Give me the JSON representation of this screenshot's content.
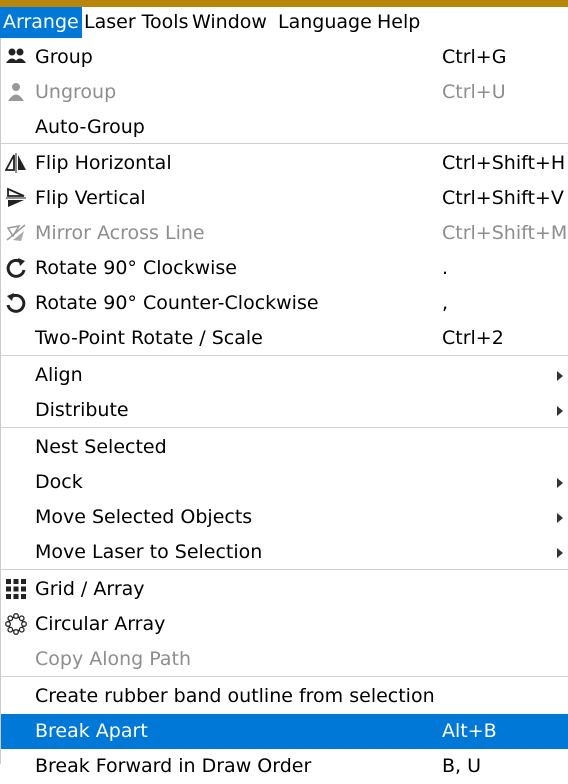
{
  "menubar": {
    "items": [
      {
        "label": "Arrange"
      },
      {
        "label": "Laser Tools"
      },
      {
        "label": "Window"
      },
      {
        "label": "Language"
      },
      {
        "label": "Help"
      }
    ]
  },
  "menu": {
    "items": [
      {
        "label": "Group",
        "shortcut": "Ctrl+G",
        "icon": "group-icon"
      },
      {
        "label": "Ungroup",
        "shortcut": "Ctrl+U",
        "icon": "ungroup-icon",
        "disabled": true
      },
      {
        "label": "Auto-Group",
        "shortcut": ""
      },
      {
        "label": "Flip Horizontal",
        "shortcut": "Ctrl+Shift+H",
        "icon": "flip-horizontal-icon"
      },
      {
        "label": "Flip Vertical",
        "shortcut": "Ctrl+Shift+V",
        "icon": "flip-vertical-icon"
      },
      {
        "label": "Mirror Across Line",
        "shortcut": "Ctrl+Shift+M",
        "icon": "mirror-across-line-icon",
        "disabled": true
      },
      {
        "label": "Rotate 90° Clockwise",
        "shortcut": ".",
        "icon": "rotate-clockwise-icon"
      },
      {
        "label": "Rotate 90° Counter-Clockwise",
        "shortcut": ",",
        "icon": "rotate-counter-clockwise-icon"
      },
      {
        "label": "Two-Point Rotate / Scale",
        "shortcut": "Ctrl+2"
      },
      {
        "label": "Align",
        "submenu": true
      },
      {
        "label": "Distribute",
        "submenu": true
      },
      {
        "label": "Nest Selected"
      },
      {
        "label": "Dock",
        "submenu": true
      },
      {
        "label": "Move Selected Objects",
        "submenu": true
      },
      {
        "label": "Move Laser to Selection",
        "submenu": true
      },
      {
        "label": "Grid / Array",
        "icon": "grid-array-icon"
      },
      {
        "label": "Circular Array",
        "icon": "circular-array-icon"
      },
      {
        "label": "Copy Along Path",
        "disabled": true
      },
      {
        "label": "Create rubber band outline from selection"
      },
      {
        "label": "Break Apart",
        "shortcut": "Alt+B",
        "highlighted": true
      },
      {
        "label": "Break Forward in Draw Order",
        "shortcut": "B, U"
      }
    ]
  },
  "colors": {
    "accent": "#0078d7",
    "topbar": "#b8860b",
    "disabled_text": "#8e8e8e",
    "separator": "#d0d0d0"
  }
}
